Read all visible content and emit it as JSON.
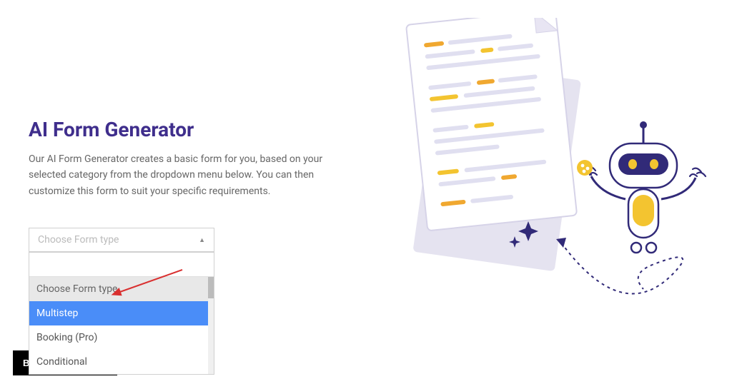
{
  "header": {
    "title": "AI Form Generator",
    "description": "Our AI Form Generator creates a basic form for you, based on your selected category from the dropdown menu below. You can then customize this form to suit your specific requirements."
  },
  "formTypeDropdown": {
    "placeholder": "Choose Form type",
    "search_value": "",
    "options": [
      {
        "label": "Choose Form type",
        "highlighted": false,
        "placeholder": true
      },
      {
        "label": "Multistep",
        "highlighted": true,
        "placeholder": false
      },
      {
        "label": "Booking (Pro)",
        "highlighted": false,
        "placeholder": false
      },
      {
        "label": "Conditional",
        "highlighted": false,
        "placeholder": false
      }
    ]
  },
  "footer": {
    "back_label": "Back to Dashboard"
  },
  "illustration": {
    "name": "ai-robot-document-illustration"
  },
  "annotation": {
    "type": "red-arrow",
    "target": "Multistep"
  }
}
